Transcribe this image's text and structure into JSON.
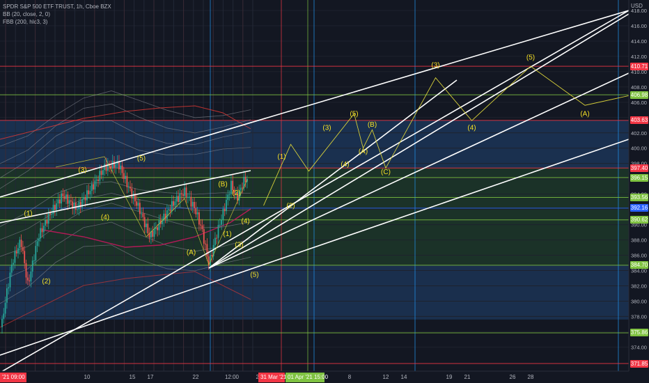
{
  "legend": {
    "line1": "SPDR S&P 500 ETF TRUST, 1h, Cboe BZX",
    "line2": "BB (20, close, 2, 0)",
    "line3": "FBB (200, hlc3, 3)"
  },
  "currency": "USD",
  "colors": {
    "background": "#131722",
    "trendline": "#ffffff",
    "wave_label": "#f5e025",
    "projection": "#d6cf3a",
    "level_red": "#f23645",
    "level_green": "#7fc241",
    "level_blue": "#2962ff",
    "zone_blue": "#1e3a5f",
    "zone_green": "#1e3a2a",
    "bollinger": "#9598a1",
    "fbb_outer": "#e53935",
    "ma_line": "#c2185b"
  },
  "chart_data": {
    "type": "candlestick",
    "symbol": "SPDR S&P 500 ETF TRUST",
    "interval": "1h",
    "exchange": "Cboe BZX",
    "ylim": [
      371.5,
      418
    ],
    "y_ticks": [
      374,
      376,
      378,
      380,
      382,
      384,
      386,
      388,
      390,
      392,
      394,
      396,
      398,
      400,
      402,
      404,
      406,
      408,
      410,
      412,
      414,
      416,
      418
    ],
    "x_ticks": [
      {
        "label": "10",
        "day": 10
      },
      {
        "label": "15",
        "day": 15
      },
      {
        "label": "17",
        "day": 17
      },
      {
        "label": "22",
        "day": 22
      },
      {
        "label": "12:00",
        "day": 26
      },
      {
        "label": "29",
        "day": 29
      },
      {
        "label": "2",
        "day": 33
      },
      {
        "label": "8",
        "day": 39
      },
      {
        "label": "12",
        "day": 43
      },
      {
        "label": "14",
        "day": 45
      },
      {
        "label": "19",
        "day": 50
      },
      {
        "label": "21",
        "day": 52
      },
      {
        "label": "26",
        "day": 57
      },
      {
        "label": "28",
        "day": 59
      }
    ],
    "price_levels": [
      {
        "label": "410.71",
        "value": 410.71,
        "color": "red"
      },
      {
        "label": "406.98",
        "value": 406.98,
        "color": "green"
      },
      {
        "label": "403.63",
        "value": 403.63,
        "color": "red"
      },
      {
        "label": "397.40",
        "value": 397.4,
        "color": "red"
      },
      {
        "label": "396.15",
        "value": 396.15,
        "color": "green"
      },
      {
        "label": "393.56",
        "value": 393.56,
        "color": "green"
      },
      {
        "label": "392.16",
        "value": 392.16,
        "color": "blue"
      },
      {
        "label": "390.62",
        "value": 390.62,
        "color": "green"
      },
      {
        "label": "384.70",
        "value": 384.7,
        "color": "green"
      },
      {
        "label": "375.86",
        "value": 375.86,
        "color": "green"
      },
      {
        "label": "371.85",
        "value": 371.85,
        "color": "red"
      }
    ],
    "time_badges": [
      {
        "label": "'21  09:00",
        "color": "red"
      },
      {
        "label": "31 Mar '21",
        "color": "red"
      },
      {
        "label": "01 Apr '21  15:00",
        "color": "green"
      }
    ],
    "wave_labels": [
      {
        "text": "(1)",
        "day": 3.5,
        "y": 391.2
      },
      {
        "text": "(2)",
        "day": 5.5,
        "y": 382.3
      },
      {
        "text": "(3)",
        "day": 9.5,
        "y": 396.9
      },
      {
        "text": "(4)",
        "day": 12,
        "y": 390.7
      },
      {
        "text": "(5)",
        "day": 16,
        "y": 398.4
      },
      {
        "text": "(A)",
        "day": 21.5,
        "y": 386.1
      },
      {
        "text": "(B)",
        "day": 25,
        "y": 395.0
      },
      {
        "text": "(2)",
        "day": 26.5,
        "y": 393.9
      },
      {
        "text": "(4)",
        "day": 27.5,
        "y": 390.2
      },
      {
        "text": "(1)",
        "day": 25.5,
        "y": 388.5
      },
      {
        "text": "(3)",
        "day": 26.8,
        "y": 387.1
      },
      {
        "text": "(5)",
        "day": 28.5,
        "y": 383.2
      },
      {
        "text": "(1)",
        "day": 31.5,
        "y": 398.6
      },
      {
        "text": "(2)",
        "day": 32.5,
        "y": 392.2
      },
      {
        "text": "(3)",
        "day": 36.5,
        "y": 402.4
      },
      {
        "text": "(4)",
        "day": 38.5,
        "y": 397.6
      },
      {
        "text": "(5)",
        "day": 39.5,
        "y": 404.2
      },
      {
        "text": "(A)",
        "day": 40.5,
        "y": 399.3
      },
      {
        "text": "(B)",
        "day": 41.5,
        "y": 402.8
      },
      {
        "text": "(C)",
        "day": 43,
        "y": 396.6
      },
      {
        "text": "(3)",
        "day": 48.5,
        "y": 410.6
      },
      {
        "text": "(4)",
        "day": 52.5,
        "y": 402.4
      },
      {
        "text": "(5)",
        "day": 59,
        "y": 411.6
      },
      {
        "text": "(A)",
        "day": 65,
        "y": 404.2
      }
    ],
    "projection_path": [
      {
        "day": 29.5,
        "y": 392.5
      },
      {
        "day": 32.5,
        "y": 400.5
      },
      {
        "day": 34.5,
        "y": 397.0
      },
      {
        "day": 39.5,
        "y": 404.5
      },
      {
        "day": 40.5,
        "y": 400.0
      },
      {
        "day": 41.5,
        "y": 402.4
      },
      {
        "day": 43,
        "y": 397.4
      },
      {
        "day": 48.5,
        "y": 409.2
      },
      {
        "day": 52.5,
        "y": 403.6
      },
      {
        "day": 59,
        "y": 410.7
      },
      {
        "day": 65,
        "y": 405.6
      },
      {
        "day": 70,
        "y": 406.9
      }
    ]
  }
}
